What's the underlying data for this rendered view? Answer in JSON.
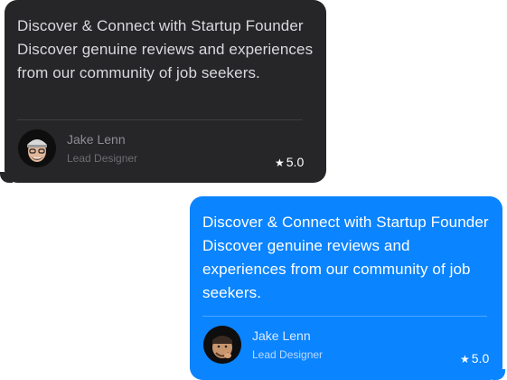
{
  "reviews": [
    {
      "text": "Discover & Connect with Startup Founder Discover genuine reviews and experiences from our community of job seekers.",
      "author": "Jake Lenn",
      "role": "Lead Designer",
      "rating": "5.0",
      "star_icon": "star-icon",
      "theme": "dark",
      "bubble_color": "#262628"
    },
    {
      "text": "Discover & Connect with Startup Founder Discover genuine reviews and experiences from our community of job seekers.",
      "author": "Jake Lenn",
      "role": "Lead Designer",
      "rating": "5.0",
      "star_icon": "star-icon",
      "theme": "blue",
      "bubble_color": "#0a84ff"
    }
  ]
}
